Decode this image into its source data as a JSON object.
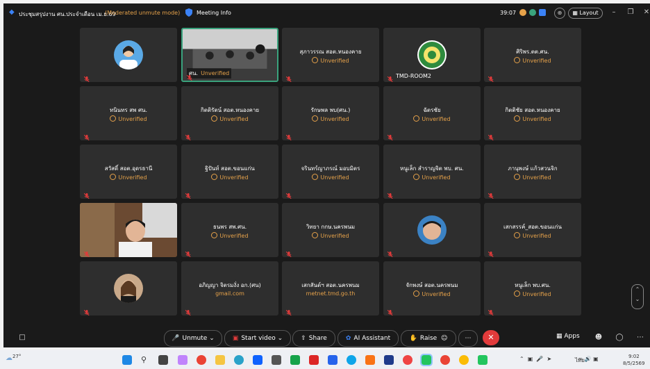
{
  "titlebar": {
    "meeting_title": "ประชุมสรุปงาน ศน.ประจำเดือน เม.ย.69",
    "mode": "(Moderated unmute mode)",
    "meeting_info": "Meeting Info",
    "timer": "39:07",
    "layout_label": "Layout"
  },
  "tiles": [
    {
      "name": "",
      "status": ""
    },
    {
      "name": "ศน.",
      "status": "Unverified"
    },
    {
      "name": "สุภาวรรณ สอต.หนองคาย",
      "status": "Unverified"
    },
    {
      "name": "TMD-ROOM2",
      "status": ""
    },
    {
      "name": "ศิริพร.ตต.ศน.",
      "status": "Unverified"
    },
    {
      "name": "ทนินทร สพ ศน.",
      "status": "Unverified"
    },
    {
      "name": "กิตติรัตน์ สอต.หนองคาย",
      "status": "Unverified"
    },
    {
      "name": "รักษพล พบ(ศน.)",
      "status": "Unverified"
    },
    {
      "name": "ฉัตรชัย",
      "status": "Unverified"
    },
    {
      "name": "กิตติชัย สอต.หนองคาย",
      "status": "Unverified"
    },
    {
      "name": "สวัสดิ์ สอต.อุดรธานี",
      "status": "Unverified"
    },
    {
      "name": "ฐิปันท์ สอต.ขอนแก่น",
      "status": "Unverified"
    },
    {
      "name": "จรินทร์ญาภรณ์ มอบมิตร",
      "status": "Unverified"
    },
    {
      "name": "หนูเล็ก สำราญจิต พบ. ศน.",
      "status": "Unverified"
    },
    {
      "name": "ภานุพงษ์ แก้วสวนจิก",
      "status": "Unverified"
    },
    {
      "name": "",
      "status": ""
    },
    {
      "name": "ธนพร สพ.ศน.",
      "status": "Unverified"
    },
    {
      "name": "วิทยา กกษ.นครพนม",
      "status": "Unverified"
    },
    {
      "name": "",
      "status": ""
    },
    {
      "name": "เสกสรรค์_สอต.ขอนแก่น",
      "status": "Unverified"
    },
    {
      "name": "",
      "status": ""
    },
    {
      "name": "อภิญญา จิตรมงั่ง อก.(ศน)",
      "status": "gmail.com"
    },
    {
      "name": "เสกสันต์ฯ สอต.นครพนม",
      "status": "metnet.tmd.go.th"
    },
    {
      "name": "จักพงษ์ สอต.นครพนม",
      "status": "Unverified"
    },
    {
      "name": "หนูเล็ก พบ.ศน.",
      "status": "Unverified"
    }
  ],
  "toolbar": {
    "unmute": "Unmute",
    "start_video": "Start video",
    "share": "Share",
    "ai_assistant": "AI Assistant",
    "raise": "Raise",
    "apps": "Apps"
  },
  "taskbar": {
    "temperature": "27°",
    "lang": "ไทย",
    "time": "9:02",
    "date": "8/5/2569"
  },
  "colors": {
    "accent_orange": "#e6a24a",
    "muted_red": "#e23b3b",
    "active_border": "#3aa37d"
  }
}
